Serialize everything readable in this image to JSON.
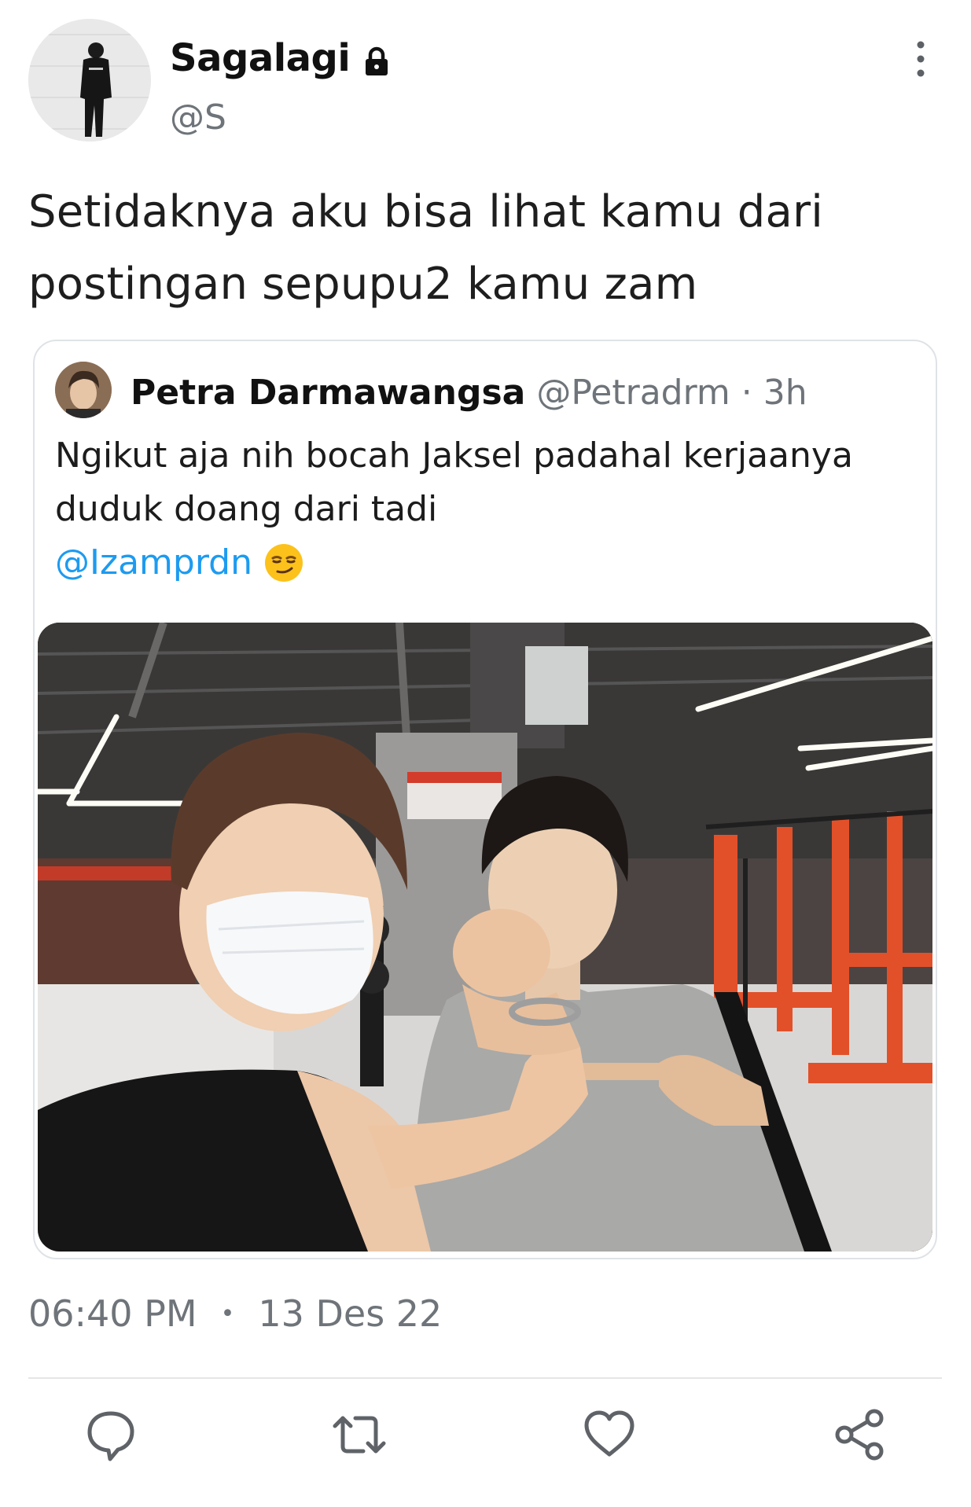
{
  "tweet": {
    "author_name": "Sagalagi",
    "author_handle": "@S",
    "text_line1": "Setidaknya aku bisa lihat kamu dari",
    "text_line2": "postingan sepupu2 kamu zam",
    "time": "06:40 PM",
    "separator": "•",
    "date": "13 Des 22"
  },
  "quote": {
    "author_name": "Petra Darmawangsa",
    "author_handle": "@Petradrm",
    "meta_separator": " · ",
    "age": "3h",
    "text_line1": "Ngikut aja nih bocah Jaksel  padahal  kerjaanya",
    "text_line2": "duduk doang dari tadi",
    "mention": "@Izamprdn"
  },
  "icons": {
    "lock": "lock-icon",
    "more": "more-vertical-icon",
    "emoji": "smirking-face-emoji",
    "reply": "reply-icon",
    "retweet": "retweet-icon",
    "like": "heart-icon",
    "share": "share-icon"
  },
  "colors": {
    "mention": "#1d9bf0",
    "secondary_text": "#6e7479",
    "border": "#dfe3e6",
    "gym_orange": "#e2502a"
  }
}
